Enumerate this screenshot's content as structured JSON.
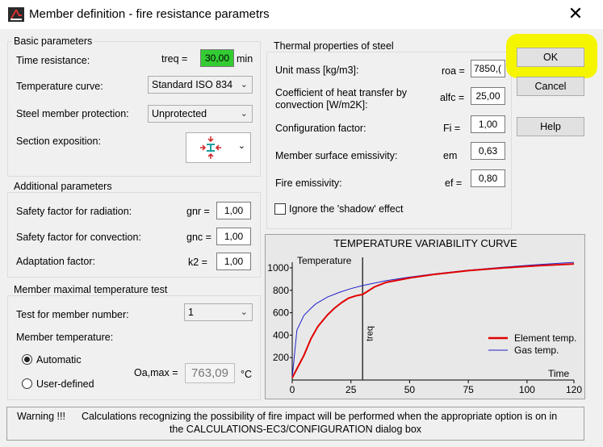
{
  "window": {
    "title": "Member definition  - fire resistance parametrs",
    "close": "✕"
  },
  "basic": {
    "title": "Basic parameters",
    "time_label": "Time resistance:",
    "treq_label": "treq =",
    "treq_value": "30,00",
    "treq_unit": "min",
    "curve_label": "Temperature curve:",
    "curve_value": "Standard ISO 834",
    "protection_label": "Steel member protection:",
    "protection_value": "Unprotected",
    "exposition_label": "Section exposition:"
  },
  "additional": {
    "title": "Additional parameters",
    "rows": [
      {
        "label": "Safety factor for radiation:",
        "sym": "gnr =",
        "value": "1,00"
      },
      {
        "label": "Safety factor for convection:",
        "sym": "gnc =",
        "value": "1,00"
      },
      {
        "label": "Adaptation factor:",
        "sym": "k2 =",
        "value": "1,00"
      }
    ]
  },
  "maxtemp": {
    "title": "Member maximal temperature test",
    "test_label": "Test for member number:",
    "test_value": "1",
    "temp_label": "Member temperature:",
    "auto_label": "Automatic",
    "user_label": "User-defined",
    "oa_label": "Oa,max =",
    "oa_value": "763,09",
    "oa_unit": "°C"
  },
  "thermal": {
    "title": "Thermal properties of steel",
    "rows": [
      {
        "label": "Unit mass [kg/m3]:",
        "sym": "roa =",
        "value": "7850,("
      },
      {
        "label": "Coefficient of heat transfer by convection [W/m2K]:",
        "sym": "alfc =",
        "value": "25,00"
      },
      {
        "label": "Configuration factor:",
        "sym": "Fi =",
        "value": "1,00"
      },
      {
        "label": "Member surface emissivity:",
        "sym": "em",
        "value": "0,63"
      },
      {
        "label": "Fire emissivity:",
        "sym": "ef =",
        "value": "0,80"
      }
    ],
    "shadow_label": "Ignore the 'shadow' effect"
  },
  "buttons": {
    "ok": "OK",
    "cancel": "Cancel",
    "help": "Help"
  },
  "warning": {
    "prefix": "Warning !!!",
    "line1": "Calculations recognizing the possibility of fire impact will be performed when the appropriate option is on in",
    "line2": "the CALCULATIONS-EC3/CONFIGURATION dialog box"
  },
  "colors": {
    "element": "#e00000",
    "gas": "#2020c8",
    "treq_bg": "#33cc33",
    "highlight": "#f5f500"
  },
  "chart_data": {
    "type": "line",
    "title": "TEMPERATURE VARIABILITY CURVE",
    "xlabel": "Time",
    "ylabel": "Temperature",
    "xlim": [
      0,
      120
    ],
    "ylim": [
      0,
      1050
    ],
    "xticks": [
      0,
      25,
      50,
      75,
      100,
      120
    ],
    "yticks": [
      200,
      400,
      600,
      800,
      1000
    ],
    "legend_position": "right",
    "marker": {
      "x": 30,
      "label": "treq"
    },
    "series": [
      {
        "name": "Element temp.",
        "color": "#e00000",
        "x": [
          0,
          2,
          5,
          8,
          11,
          15,
          18,
          21,
          24,
          27,
          30,
          35,
          40,
          50,
          60,
          75,
          90,
          105,
          120
        ],
        "y": [
          20,
          100,
          220,
          370,
          480,
          580,
          640,
          690,
          730,
          750,
          763,
          830,
          870,
          910,
          940,
          975,
          1000,
          1020,
          1035
        ]
      },
      {
        "name": "Gas temp.",
        "color": "#2020c8",
        "x": [
          0,
          2,
          5,
          8,
          10,
          15,
          20,
          25,
          30,
          40,
          50,
          60,
          75,
          90,
          105,
          120
        ],
        "y": [
          20,
          445,
          576,
          640,
          678,
          739,
          781,
          815,
          842,
          885,
          918,
          945,
          979,
          1006,
          1029,
          1049
        ]
      }
    ]
  }
}
